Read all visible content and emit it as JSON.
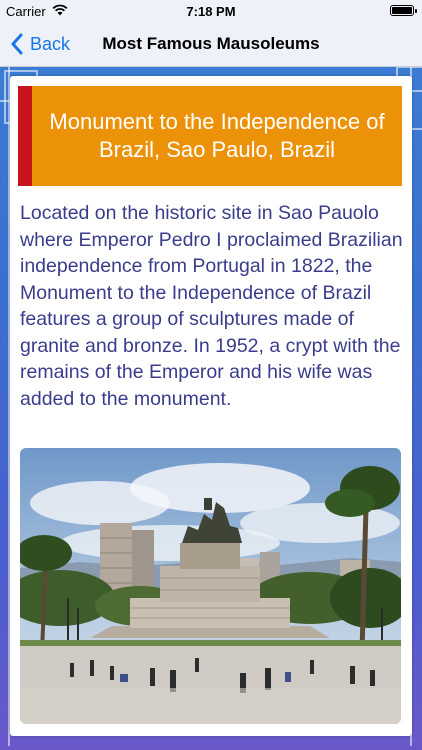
{
  "status_bar": {
    "carrier": "Carrier",
    "time": "7:18 PM",
    "battery_level": 1.0
  },
  "nav": {
    "back_label": "Back",
    "title": "Most Famous Mausoleums"
  },
  "article": {
    "title": "Monument to the Independence of Brazil, Sao Paulo, Brazil",
    "description": "Located on the historic site in Sao Pauolo where Emperor Pedro I proclaimed Brazilian independence from Portugal in 1822, the Monument to the Independence of Brazil features a group of sculptures made of granite and bronze. In 1952, a crypt with the remains of the Emperor and his wife was added to the monument.",
    "image_alt": ""
  },
  "colors": {
    "accent": "#1677e8",
    "banner": "#ec9209",
    "banner_stripe": "#c8141a",
    "body_text": "#3a3d8c"
  }
}
